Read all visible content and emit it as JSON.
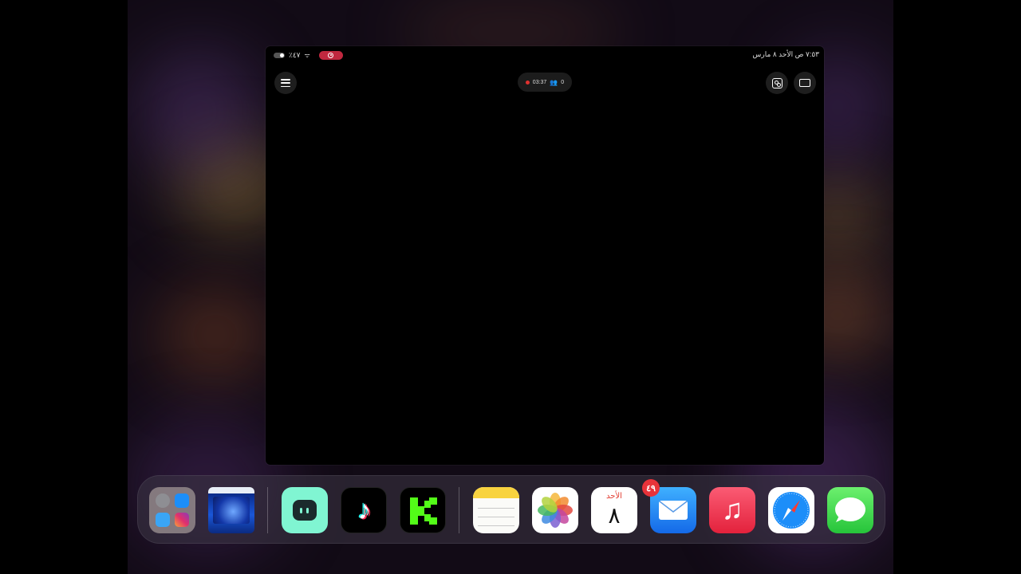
{
  "status_bar": {
    "battery": "٪٤٧",
    "datetime": "٧:٥٣ ص   الأحد ٨ مارس"
  },
  "session": {
    "timer": "03:37",
    "viewers": "0"
  },
  "calendar": {
    "weekday": "الأحد",
    "day": "٨"
  },
  "mail": {
    "badge": "٤٩"
  },
  "colors": {
    "record": "#c0283f",
    "badge": "#e8333a",
    "kick": "#53fc18",
    "streamlabs": "#80f5d2"
  },
  "dock": {
    "apps": [
      "app-library-folder",
      "recent-app",
      "streamlabs",
      "tiktok",
      "kick",
      "notes",
      "photos",
      "calendar",
      "mail",
      "music",
      "safari",
      "messages"
    ]
  }
}
